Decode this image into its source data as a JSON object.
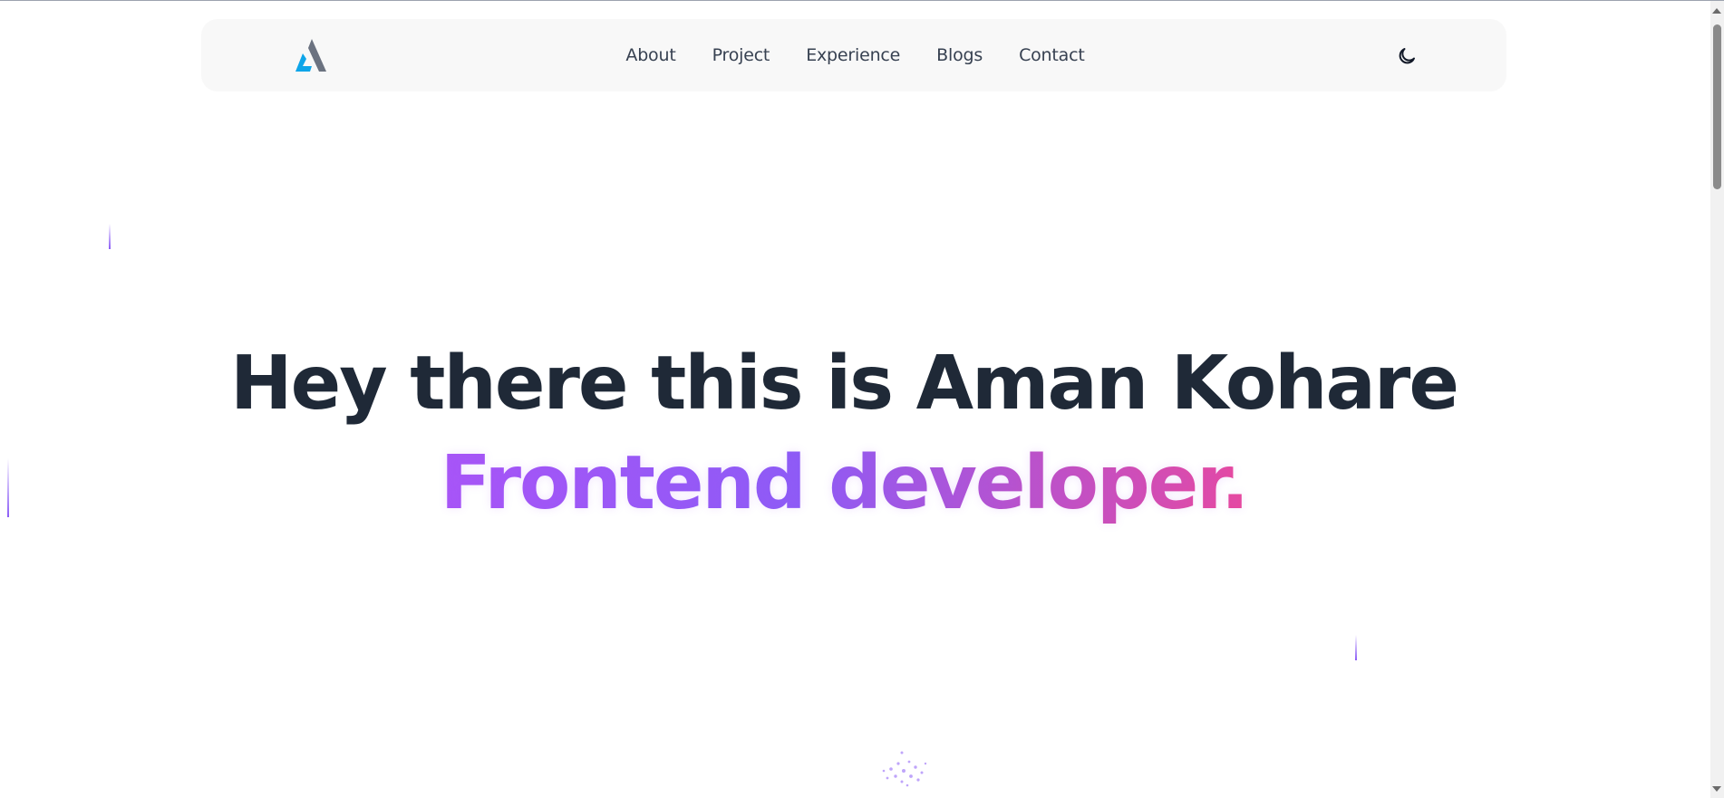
{
  "nav": {
    "logo_icon": "triangle-logo-icon",
    "links": [
      "About",
      "Project",
      "Experience",
      "Blogs",
      "Contact"
    ],
    "theme_icon": "moon-icon"
  },
  "hero": {
    "title": "Hey there this is Aman Kohare",
    "subtitle": "Frontend developer."
  },
  "colors": {
    "nav_bg": "#f8f8f8",
    "title": "#1f2937",
    "gradient_start": "#a855f7",
    "gradient_mid": "#8b5cf6",
    "gradient_end": "#ec4899"
  }
}
